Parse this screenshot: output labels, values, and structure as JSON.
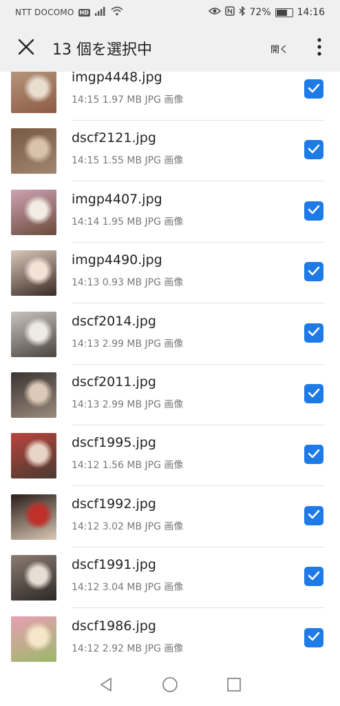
{
  "status_bar": {
    "carrier": "NTT DOCOMO",
    "network_badge": "HD",
    "battery_text": "72%",
    "battery_level": 0.72,
    "time": "14:16",
    "icons": [
      "signal-icon",
      "wifi-icon",
      "eye-icon",
      "nfc-icon",
      "bluetooth-icon",
      "battery-icon"
    ]
  },
  "app_bar": {
    "title": "13 個を選択中",
    "open_label": "開く",
    "icons": [
      "close-icon",
      "more-vert-icon"
    ]
  },
  "accent_color": "#1e7ae6",
  "files": [
    {
      "name": "imgp4448.jpg",
      "meta": "14:15 1.97 MB JPG 画像",
      "selected": true,
      "thumb": [
        "#b89a7e",
        "#e9ddd0",
        "#8c5a44"
      ]
    },
    {
      "name": "dscf2121.jpg",
      "meta": "14:15 1.55 MB JPG 画像",
      "selected": true,
      "thumb": [
        "#7a5a44",
        "#d8c3a8",
        "#a08670"
      ]
    },
    {
      "name": "imgp4407.jpg",
      "meta": "14:14 1.95 MB JPG 画像",
      "selected": true,
      "thumb": [
        "#cfa3b4",
        "#f2ece4",
        "#6a4a3a"
      ]
    },
    {
      "name": "imgp4490.jpg",
      "meta": "14:13 0.93 MB JPG 画像",
      "selected": true,
      "thumb": [
        "#d9c8bb",
        "#f3e2d6",
        "#3a2a22"
      ]
    },
    {
      "name": "dscf2014.jpg",
      "meta": "14:13 2.99 MB JPG 画像",
      "selected": true,
      "thumb": [
        "#c9c4c0",
        "#eeeae6",
        "#4a4440"
      ]
    },
    {
      "name": "dscf2011.jpg",
      "meta": "14:13 2.99 MB JPG 画像",
      "selected": true,
      "thumb": [
        "#3a3432",
        "#dcc9b8",
        "#9b8a7c"
      ]
    },
    {
      "name": "dscf1995.jpg",
      "meta": "14:12 1.56 MB JPG 画像",
      "selected": true,
      "thumb": [
        "#b8453c",
        "#e8d4c6",
        "#4a3a30"
      ]
    },
    {
      "name": "dscf1992.jpg",
      "meta": "14:12 3.02 MB JPG 画像",
      "selected": true,
      "thumb": [
        "#2a1c18",
        "#c0302a",
        "#d9c8b4"
      ]
    },
    {
      "name": "dscf1991.jpg",
      "meta": "14:12 3.04 MB JPG 画像",
      "selected": true,
      "thumb": [
        "#8a7d72",
        "#e6ddd4",
        "#2e2826"
      ]
    },
    {
      "name": "dscf1986.jpg",
      "meta": "14:12 2.92 MB JPG 画像",
      "selected": true,
      "thumb": [
        "#e89fb4",
        "#f4e6c8",
        "#9bb86a"
      ]
    }
  ],
  "nav_bar": {
    "icons": [
      "back-icon",
      "home-icon",
      "recents-icon"
    ]
  }
}
